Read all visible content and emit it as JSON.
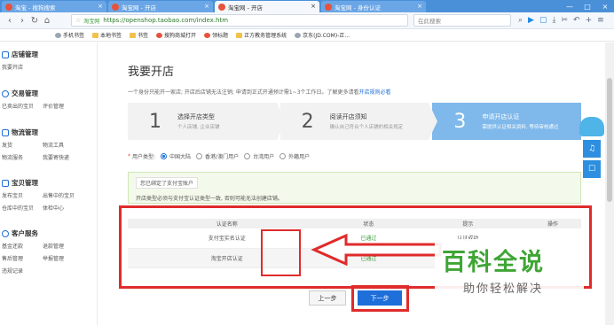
{
  "tabs": [
    {
      "title": "淘宝 - 搜狗搜索",
      "active": false
    },
    {
      "title": "淘宝网 - 开店",
      "active": false
    },
    {
      "title": "淘宝网 - 开店",
      "active": true
    },
    {
      "title": "淘宝网 - 身份认证",
      "active": false
    }
  ],
  "address": {
    "secure_label": "淘宝网",
    "url": "https://openshop.taobao.com/index.htm",
    "search_placeholder": "在此搜索"
  },
  "bookmarks": [
    "手机书签",
    "本地书签",
    "书签",
    "搜狗商城打开",
    "领标题",
    "正方教务管理系统",
    "京东(JD.COM)-正..."
  ],
  "sidebar": {
    "groups": [
      {
        "title": "店铺管理",
        "items": [
          "我要开店"
        ]
      },
      {
        "title": "交易管理",
        "items": [
          "已卖出的宝贝",
          "评价管理"
        ]
      },
      {
        "title": "物流管理",
        "items": [
          "发货",
          "物流工具",
          "物流服务",
          "我要寄快递"
        ]
      },
      {
        "title": "宝贝管理",
        "items": [
          "发布宝贝",
          "出售中的宝贝",
          "仓库中的宝贝",
          "体检中心"
        ]
      },
      {
        "title": "客户服务",
        "items": [
          "基金还款",
          "退款管理",
          "售后管理",
          "举报管理",
          "违规记录"
        ]
      }
    ]
  },
  "main": {
    "title": "我要开店",
    "intro": "一个身份只能开一家店; 开店后店铺无法注销; 申请到正式开通预计需1~3个工作日。了解更多请看",
    "intro_link": "开店规则必看",
    "steps": [
      {
        "num": "1",
        "title": "选择开店类型",
        "sub": "个人店铺, 企业店铺"
      },
      {
        "num": "2",
        "title": "阅读开店须知",
        "sub": "确认自己符合个人店铺的相关规定"
      },
      {
        "num": "3",
        "title": "申请开店认证",
        "sub": "需提供认证相关资料, 等待审核通过"
      }
    ],
    "user_type_label": "用户类型:",
    "user_types": [
      "中国大陆",
      "香港/澳门用户",
      "台湾用户",
      "外籍用户"
    ],
    "alert_bound": "您已绑定了支付宝账户",
    "alert_note": "开店类型必须与支付宝认证类型一致, 否则可能无法创建店铺。",
    "table": {
      "headers": [
        "认证名称",
        "状态",
        "提示",
        "操作"
      ],
      "rows": [
        {
          "name": "支付宝实名认证",
          "status": "已通过",
          "tip": "认证成功",
          "op": ""
        },
        {
          "name": "淘宝开店认证",
          "status": "已通过",
          "tip": "",
          "op": ""
        }
      ]
    },
    "prev_label": "上一步",
    "next_label": "下一步"
  },
  "watermark": {
    "big": "百科全说",
    "small": "助你轻松解决"
  },
  "colors": {
    "accent": "#1e6fd9",
    "highlight": "#e02b2b",
    "success": "#3c9a3c",
    "step_active": "#7fb8ea"
  }
}
